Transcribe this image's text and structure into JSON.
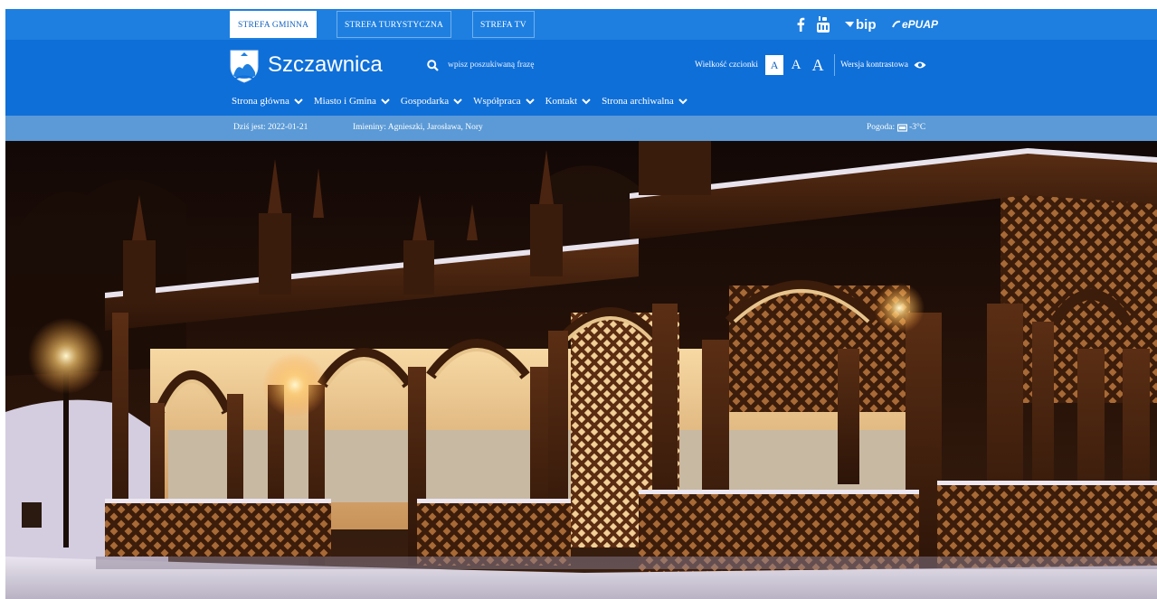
{
  "topbar": {
    "tabs": [
      {
        "label": "Strefa Gminna",
        "active": true
      },
      {
        "label": "Strefa Turystyczna",
        "active": false
      },
      {
        "label": "Strefa TV",
        "active": false
      }
    ],
    "social": {
      "facebook_icon": "facebook-icon",
      "youtube_icon": "youtube-icon",
      "bip_label": "bip",
      "epuap_label": "ePUAP"
    }
  },
  "header": {
    "site_name": "Szczawnica",
    "search_placeholder": "wpisz poszukiwaną frazę",
    "font_size_label": "Wielkość czcionki",
    "font_sizes": [
      "A",
      "A",
      "A"
    ],
    "contrast_label": "Wersja kontrastowa",
    "nav": [
      "Strona główna",
      "Miasto i Gmina",
      "Gospodarka",
      "Współpraca",
      "Kontakt",
      "Strona archiwalna"
    ]
  },
  "infobar": {
    "date": "Dziś jest: 2022-01-21",
    "namedays": "Imieniny: Agnieszki, Jarosława, Nory",
    "weather_label": "Pogoda:",
    "weather_temp": "-3°C"
  },
  "colors": {
    "primary": "#0f6fd8",
    "topbar": "#1e7fe0",
    "infobar": "#5b9ad6"
  }
}
